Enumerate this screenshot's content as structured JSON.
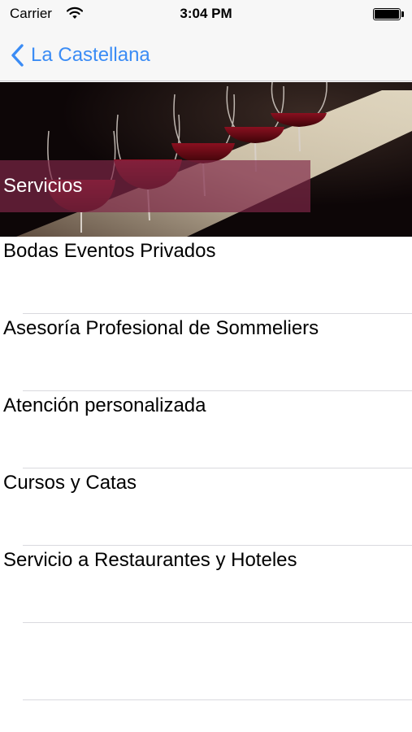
{
  "status_bar": {
    "carrier": "Carrier",
    "time": "3:04 PM",
    "icons": [
      "wifi-icon",
      "battery-icon"
    ]
  },
  "nav": {
    "back_label": "La Castellana",
    "back_icon": "chevron-left-icon",
    "tint_color": "#3b8cf5"
  },
  "hero": {
    "title": "Servicios",
    "banner_color": "#802848"
  },
  "list": {
    "items": [
      {
        "label": "Bodas Eventos Privados"
      },
      {
        "label": "Asesoría Profesional de Sommeliers"
      },
      {
        "label": "Atención personalizada"
      },
      {
        "label": "Cursos y Catas"
      },
      {
        "label": "Servicio a Restaurantes y Hoteles"
      }
    ]
  }
}
